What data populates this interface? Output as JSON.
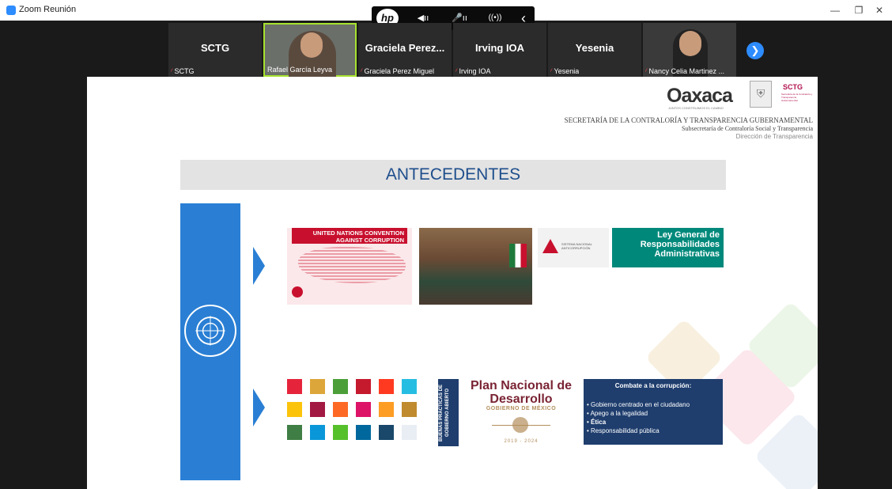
{
  "window": {
    "title": "Zoom Reunión"
  },
  "hp_toolbar": {
    "logo": "hp",
    "speaker": "◀ıı",
    "mic": "🎤ıı",
    "broadcast": "((•))",
    "collapse": "‹"
  },
  "participants": [
    {
      "name": "SCTG",
      "label": "SCTG",
      "muted": true,
      "video": false
    },
    {
      "name": "",
      "label": "Rafael García Leyva",
      "muted": false,
      "video": true
    },
    {
      "name": "Graciela Perez...",
      "label": "Graciela Perez Miguel",
      "muted": true,
      "video": false
    },
    {
      "name": "Irving IOA",
      "label": "Irving IOA",
      "muted": true,
      "video": false
    },
    {
      "name": "Yesenia",
      "label": "Yesenia",
      "muted": true,
      "video": false
    },
    {
      "name": "",
      "label": "Nancy Celia Martinez ...",
      "muted": true,
      "video": true
    }
  ],
  "slide": {
    "oaxaca_logo": "Oaxaca",
    "oaxaca_sub": "JUNTOS CONSTRUIMOS EL CAMBIO",
    "sctg_logo": "SCTG",
    "sctg_sub": "Secretaría de la Contraloría y Transparencia Gubernamental",
    "header_line1": "SECRETARÍA DE LA CONTRALORÍA Y TRANSPARENCIA GUBERNAMENTAL",
    "header_line2": "Subsecretaría de Contraloría Social y Transparencia",
    "header_line3": "Dirección de Transparencia",
    "title": "ANTECEDENTES",
    "uncac_title": "UNITED NATIONS CONVENTION AGAINST CORRUPTION",
    "sna_text": "SISTEMA NACIONAL ANTICORRUPCIÓN",
    "ley_text": "Ley General de Responsabilidades Administrativas",
    "gov_abierto": "BUENAS PRÁCTICAS DE GOBIERNO ABIERTO",
    "pnd_title": "Plan Nacional de Desarrollo",
    "pnd_gov": "GOBIERNO DE MÉXICO",
    "pnd_years": "2019 - 2024",
    "combate_title": "Combate a la corrupción:",
    "combate_items": [
      "Gobierno centrado en el ciudadano",
      "Apego a la legalidad",
      "Ética",
      "Responsabilidad pública"
    ]
  },
  "colors": {
    "un_blue": "#2a7fd4",
    "accent_red": "#c8102e",
    "teal": "#00897b",
    "navy": "#1f3e6e",
    "pnd_maroon": "#7a2434",
    "zoom_blue": "#2d8cff"
  }
}
